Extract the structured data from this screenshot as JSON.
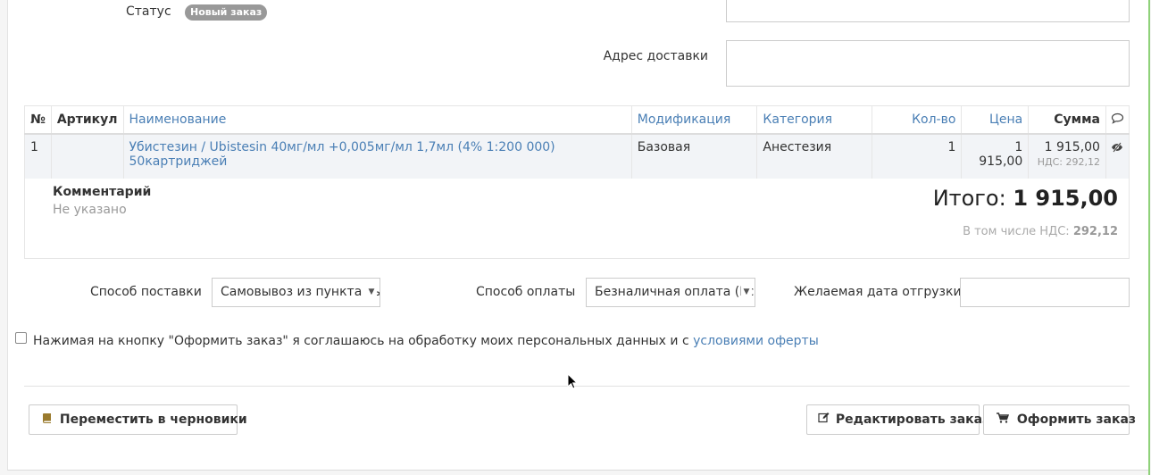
{
  "status": {
    "label": "Статус",
    "badge": "Новый заказ"
  },
  "delivery_address": {
    "label": "Адрес доставки",
    "value": ""
  },
  "table": {
    "headers": {
      "num": "№",
      "article": "Артикул",
      "name": "Наименование",
      "modification": "Модификация",
      "category": "Категория",
      "qty": "Кол-во",
      "price": "Цена",
      "sum": "Сумма"
    },
    "rows": [
      {
        "num": "1",
        "article": "",
        "name": "Убистезин / Ubistesin 40мг/мл +0,005мг/мл 1,7мл (4% 1:200 000) 50картриджей",
        "modification": "Базовая",
        "category": "Анестезия",
        "qty": "1",
        "price": "1 915,00",
        "sum": "1 915,00",
        "nds": "НДС: 292,12"
      }
    ]
  },
  "comment": {
    "title": "Комментарий",
    "value": "Не указано"
  },
  "totals": {
    "label": "Итого:",
    "value": "1 915,00",
    "nds_label": "В том числе НДС:",
    "nds_value": "292,12"
  },
  "delivery": {
    "label": "Способ поставки",
    "selected": "Самовывоз из пункта вы"
  },
  "payment": {
    "label": "Способ оплаты",
    "selected": "Безналичная оплата (Рс"
  },
  "ship_date": {
    "label": "Желаемая дата отгрузки",
    "value": ""
  },
  "agreement": {
    "text": "Нажимая на кнопку \"Оформить заказ\" я соглашаюсь на обработку моих персональных данных и с",
    "link": "условиями оферты",
    "checked": false
  },
  "buttons": {
    "draft": "Переместить в черновики",
    "edit": "Редактировать заказ",
    "checkout": "Оформить заказ"
  },
  "colors": {
    "link": "#4a7fb5",
    "badge": "#999999",
    "accent_border": "#8fd27a"
  }
}
